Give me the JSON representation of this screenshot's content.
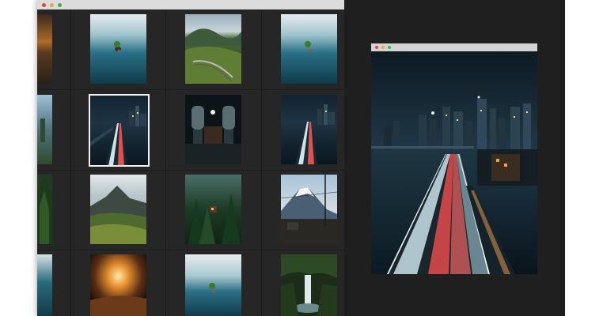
{
  "gallery": {
    "columns": 4,
    "rows": 4,
    "selected": {
      "row": 1,
      "col": 0
    },
    "thumbnails": [
      [
        "lake-island",
        "green-valley-rail",
        "lake-island"
      ],
      [
        "night-city-bridge",
        "dark-interior-chairs",
        "night-city-bridge"
      ],
      [
        "mountain-meadow",
        "forest-cabin",
        "fuji-powerlines"
      ],
      [
        "sunset-light",
        "lake-island",
        "waterfall-forest"
      ]
    ]
  },
  "preview": {
    "image": "night-city-bridge-large"
  },
  "colors": {
    "window_bg": "#262626",
    "titlebar": "#dcdcdc",
    "selection": "#f2f2f2",
    "close": "#e4453a",
    "minimize": "#e7a83c",
    "maximize": "#3fb04a"
  }
}
